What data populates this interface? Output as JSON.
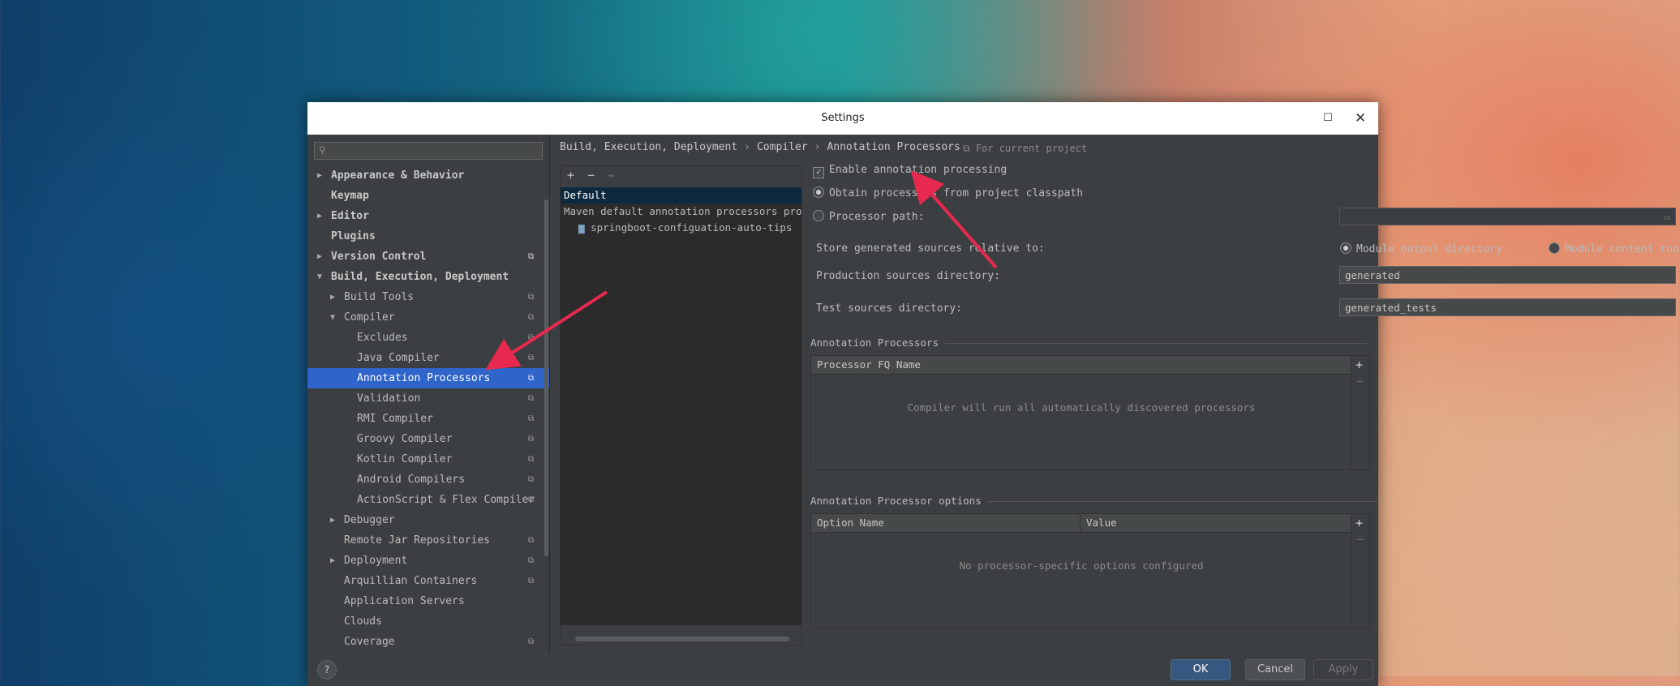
{
  "window": {
    "title": "Settings",
    "maximize_icon": "maximize-icon",
    "close_icon": "close-icon"
  },
  "search": {
    "placeholder": "",
    "icon": "search-icon"
  },
  "tree": [
    {
      "label": "Appearance & Behavior",
      "bold": true,
      "arrow": "right"
    },
    {
      "label": "Keymap",
      "bold": true
    },
    {
      "label": "Editor",
      "bold": true,
      "arrow": "right"
    },
    {
      "label": "Plugins",
      "bold": true
    },
    {
      "label": "Version Control",
      "bold": true,
      "arrow": "right",
      "copy": true
    },
    {
      "label": "Build, Execution, Deployment",
      "bold": true,
      "arrow": "down"
    },
    {
      "label": "Build Tools",
      "arrow": "right",
      "copy": true
    },
    {
      "label": "Compiler",
      "arrow": "down",
      "copy": true
    },
    {
      "label": "Excludes",
      "copy": true
    },
    {
      "label": "Java Compiler",
      "copy": true
    },
    {
      "label": "Annotation Processors",
      "copy": true,
      "selected": true
    },
    {
      "label": "Validation",
      "copy": true
    },
    {
      "label": "RMI Compiler",
      "copy": true
    },
    {
      "label": "Groovy Compiler",
      "copy": true
    },
    {
      "label": "Kotlin Compiler",
      "copy": true
    },
    {
      "label": "Android Compilers",
      "copy": true
    },
    {
      "label": "ActionScript & Flex Compiler",
      "copy": true
    },
    {
      "label": "Debugger",
      "arrow": "right"
    },
    {
      "label": "Remote Jar Repositories",
      "copy": true
    },
    {
      "label": "Deployment",
      "arrow": "right",
      "copy": true
    },
    {
      "label": "Arquillian Containers",
      "copy": true
    },
    {
      "label": "Application Servers"
    },
    {
      "label": "Clouds"
    },
    {
      "label": "Coverage",
      "copy": true
    }
  ],
  "breadcrumb": [
    "Build, Execution, Deployment",
    "Compiler",
    "Annotation Processors"
  ],
  "breadcrumb_sep": "›",
  "for_current_project": "For current project",
  "profiles_toolbar": {
    "add": "+",
    "remove": "−",
    "move": "→"
  },
  "profiles": {
    "default": "Default",
    "maven": "Maven default annotation processors profile",
    "module": "springboot-configuation-auto-tips"
  },
  "options": {
    "enable": {
      "label": "Enable annotation processing",
      "checked": true
    },
    "obtain_classpath": "Obtain processors from project classpath",
    "processor_path": "Processor path:",
    "processor_path_value": "",
    "store_label": "Store generated sources relative to:",
    "module_output": "Module output directory",
    "module_content": "Module content root",
    "production_label": "Production sources directory:",
    "production_value": "generated",
    "test_label": "Test sources directory:",
    "test_value": "generated_tests"
  },
  "processors_section": {
    "title": "Annotation Processors",
    "column": "Processor FQ Name",
    "empty": "Compiler will run all automatically discovered processors"
  },
  "options_section": {
    "title": "Annotation Processor options",
    "col_name": "Option Name",
    "col_value": "Value",
    "empty": "No processor-specific options configured"
  },
  "table_buttons": {
    "add": "+",
    "remove": "−"
  },
  "buttons": {
    "help": "?",
    "ok": "OK",
    "cancel": "Cancel",
    "apply": "Apply"
  },
  "colors": {
    "accent": "#2f65ca",
    "annotation_arrow": "#e8294f"
  }
}
